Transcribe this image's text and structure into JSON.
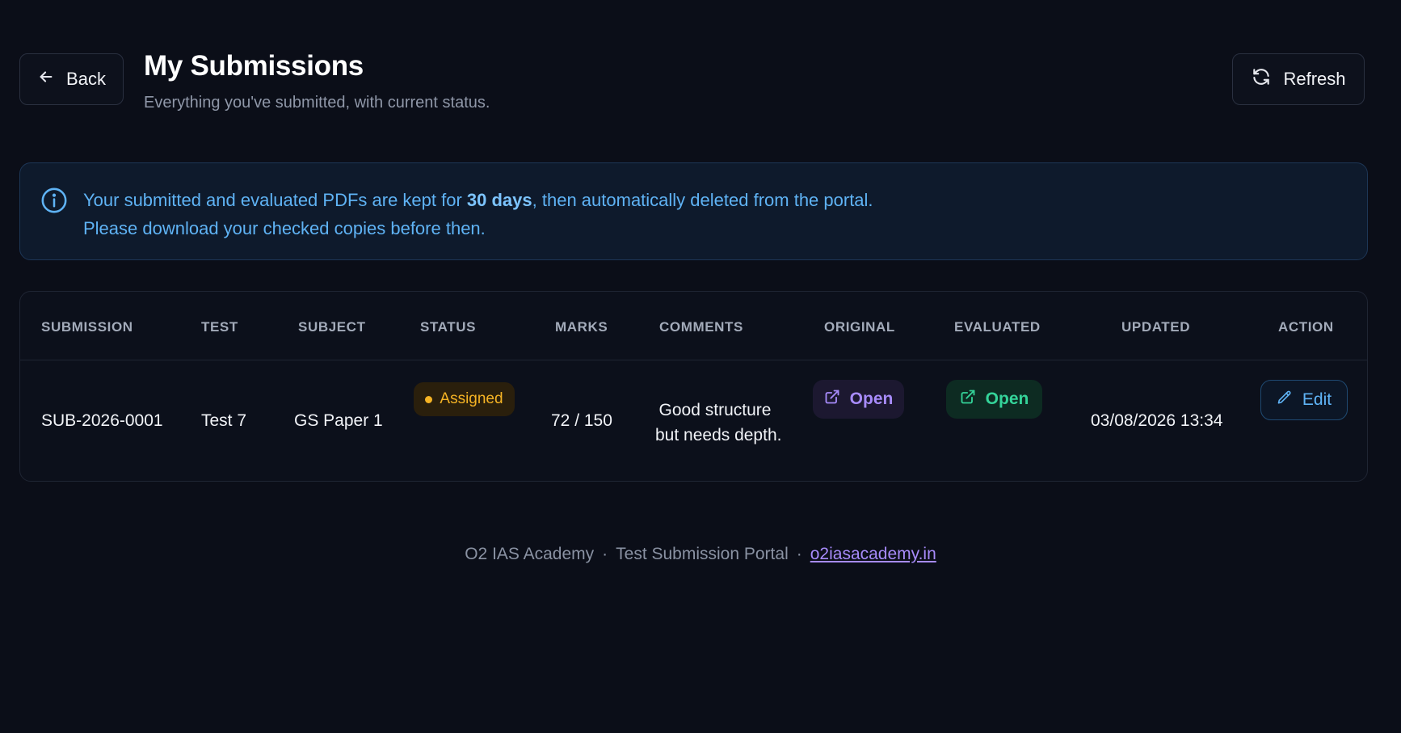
{
  "header": {
    "back_label": "Back",
    "title": "My Submissions",
    "subtitle": "Everything you've submitted, with current status.",
    "refresh_label": "Refresh"
  },
  "info": {
    "line1_prefix": "Your submitted and evaluated PDFs are kept for ",
    "line1_bold": "30 days",
    "line1_suffix": ", then automatically deleted from the portal.",
    "line2": "Please download your checked copies before then."
  },
  "table": {
    "columns": {
      "submission": "SUBMISSION",
      "test": "TEST",
      "subject": "SUBJECT",
      "status": "STATUS",
      "marks": "MARKS",
      "comments": "COMMENTS",
      "original": "ORIGINAL",
      "evaluated": "EVALUATED",
      "updated": "UPDATED",
      "action": "ACTION"
    },
    "rows": [
      {
        "submission": "SUB-2026-0001",
        "test": "Test 7",
        "subject": "GS Paper 1",
        "status": "Assigned",
        "marks": "72 / 150",
        "comments_line1": "Good structure",
        "comments_line2": "but needs depth.",
        "original_label": "Open",
        "evaluated_label": "Open",
        "updated": "03/08/2026 13:34",
        "action_label": "Edit"
      }
    ]
  },
  "footer": {
    "org": "O2 IAS Academy",
    "separator": "·",
    "portal": "Test Submission Portal",
    "link": "o2iasacademy.in"
  },
  "colors": {
    "background": "#0b0e18",
    "info_text": "#5fb3f5",
    "status_assigned": "#f5b324",
    "open_original": "#a78bfa",
    "open_evaluated": "#34d399",
    "edit": "#5fb3f5"
  },
  "icons": {
    "back": "arrow-left-icon",
    "refresh": "refresh-icon",
    "info": "info-icon",
    "open": "external-link-icon",
    "edit": "pencil-icon"
  }
}
